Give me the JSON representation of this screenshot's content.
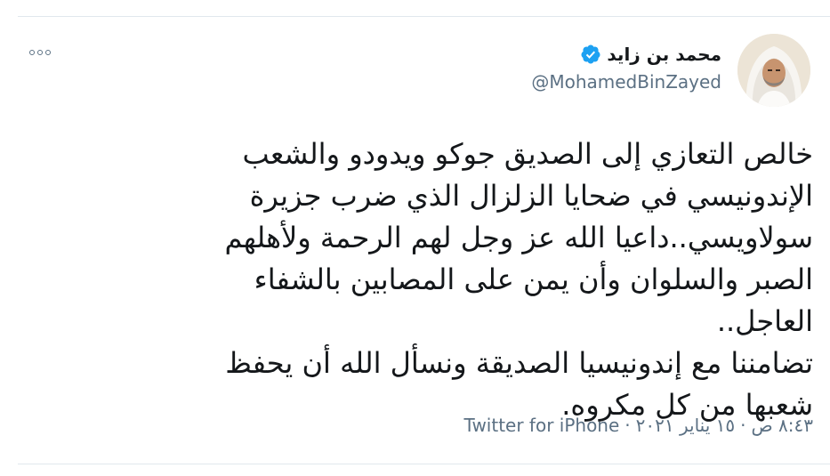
{
  "tweet": {
    "author": {
      "name": "محمد بن زايد",
      "handle": "@MohamedBinZayed",
      "verified": true,
      "avatar_icon": "profile-photo-icon"
    },
    "text": "خالص التعازي إلى الصديق جوكو ويدودو والشعب الإندونيسي في ضحايا الزلزال الذي ضرب جزيرة سولاويسي..داعيا الله عز وجل لهم الرحمة ولأهلهم الصبر والسلوان وأن يمن على المصابين بالشفاء العاجل..\nتضامننا مع إندونيسيا الصديقة ونسأل الله أن يحفظ شعبها من كل مكروه.",
    "meta": {
      "time": "٨:٤٣ ص",
      "date": "١٥ يناير ٢٠٢١",
      "separator": "·",
      "source": "Twitter for iPhone"
    },
    "more_icon": "more-options-icon",
    "colors": {
      "text": "#14171a",
      "secondary": "#5b7083",
      "verified_badge": "#1da1f2",
      "divider": "#e1e8ed"
    }
  }
}
